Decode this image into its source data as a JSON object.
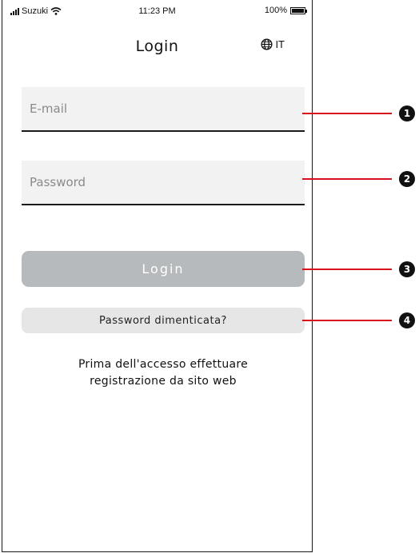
{
  "status_bar": {
    "carrier": "Suzuki",
    "time": "11:23 PM",
    "battery": "100%",
    "signal_icon": "signal-bars-icon",
    "wifi_icon": "wifi-icon",
    "battery_icon": "battery-icon"
  },
  "header": {
    "title": "Login",
    "language": "IT",
    "language_icon": "globe-icon"
  },
  "form": {
    "email_placeholder": "E-mail",
    "email_value": "",
    "password_placeholder": "Password",
    "password_value": "",
    "login_label": "Login",
    "forgot_label": "Password dimenticata?",
    "note_line1": "Prima dell'accesso effettuare",
    "note_line2": "registrazione da sito web"
  },
  "annotations": [
    "1",
    "2",
    "3",
    "4"
  ],
  "colors": {
    "annotation_line": "#d7111b",
    "login_button": "#b7babd",
    "forgot_button": "#e6e6e6",
    "field_background": "#f2f2f2"
  }
}
